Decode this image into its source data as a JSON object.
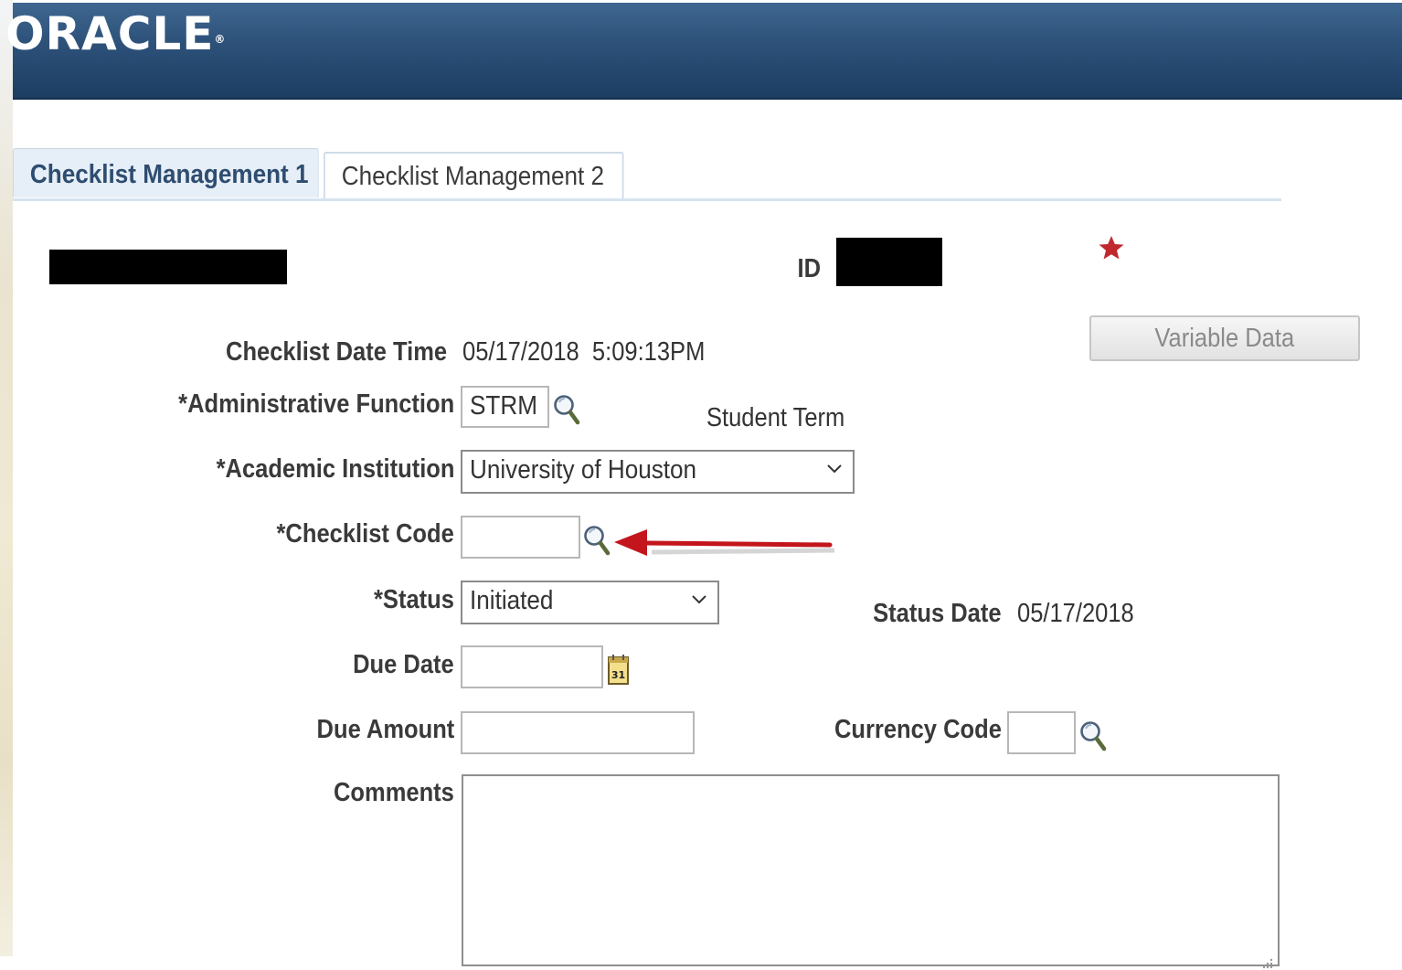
{
  "header": {
    "logo_text": "ORACLE",
    "logo_mark": "®"
  },
  "tabs": [
    {
      "label": "Checklist Management 1",
      "active": true
    },
    {
      "label": "Checklist Management 2",
      "active": false
    }
  ],
  "person": {
    "id_label": "ID"
  },
  "form": {
    "checklist_datetime_label": "Checklist Date Time",
    "checklist_datetime_value": "05/17/2018  5:09:13PM",
    "admin_function_label": "*Administrative Function",
    "admin_function_value": "STRM",
    "admin_function_desc": "Student Term",
    "institution_label": "*Academic Institution",
    "institution_value": "University of Houston",
    "checklist_code_label": "*Checklist Code",
    "checklist_code_value": "",
    "status_label": "*Status",
    "status_value": "Initiated",
    "status_date_label": "Status Date",
    "status_date_value": "05/17/2018",
    "due_date_label": "Due Date",
    "due_date_value": "",
    "calendar_day": "31",
    "due_amount_label": "Due Amount",
    "due_amount_value": "",
    "currency_code_label": "Currency Code",
    "currency_code_value": "",
    "comments_label": "Comments",
    "comments_value": ""
  },
  "buttons": {
    "variable_data": "Variable Data"
  },
  "colors": {
    "header": "#2c5078",
    "active_tab_bg": "#e6eef7",
    "active_tab_text": "#2e4d70",
    "required_star": "#c0282d",
    "annotation_arrow": "#c3161c"
  }
}
